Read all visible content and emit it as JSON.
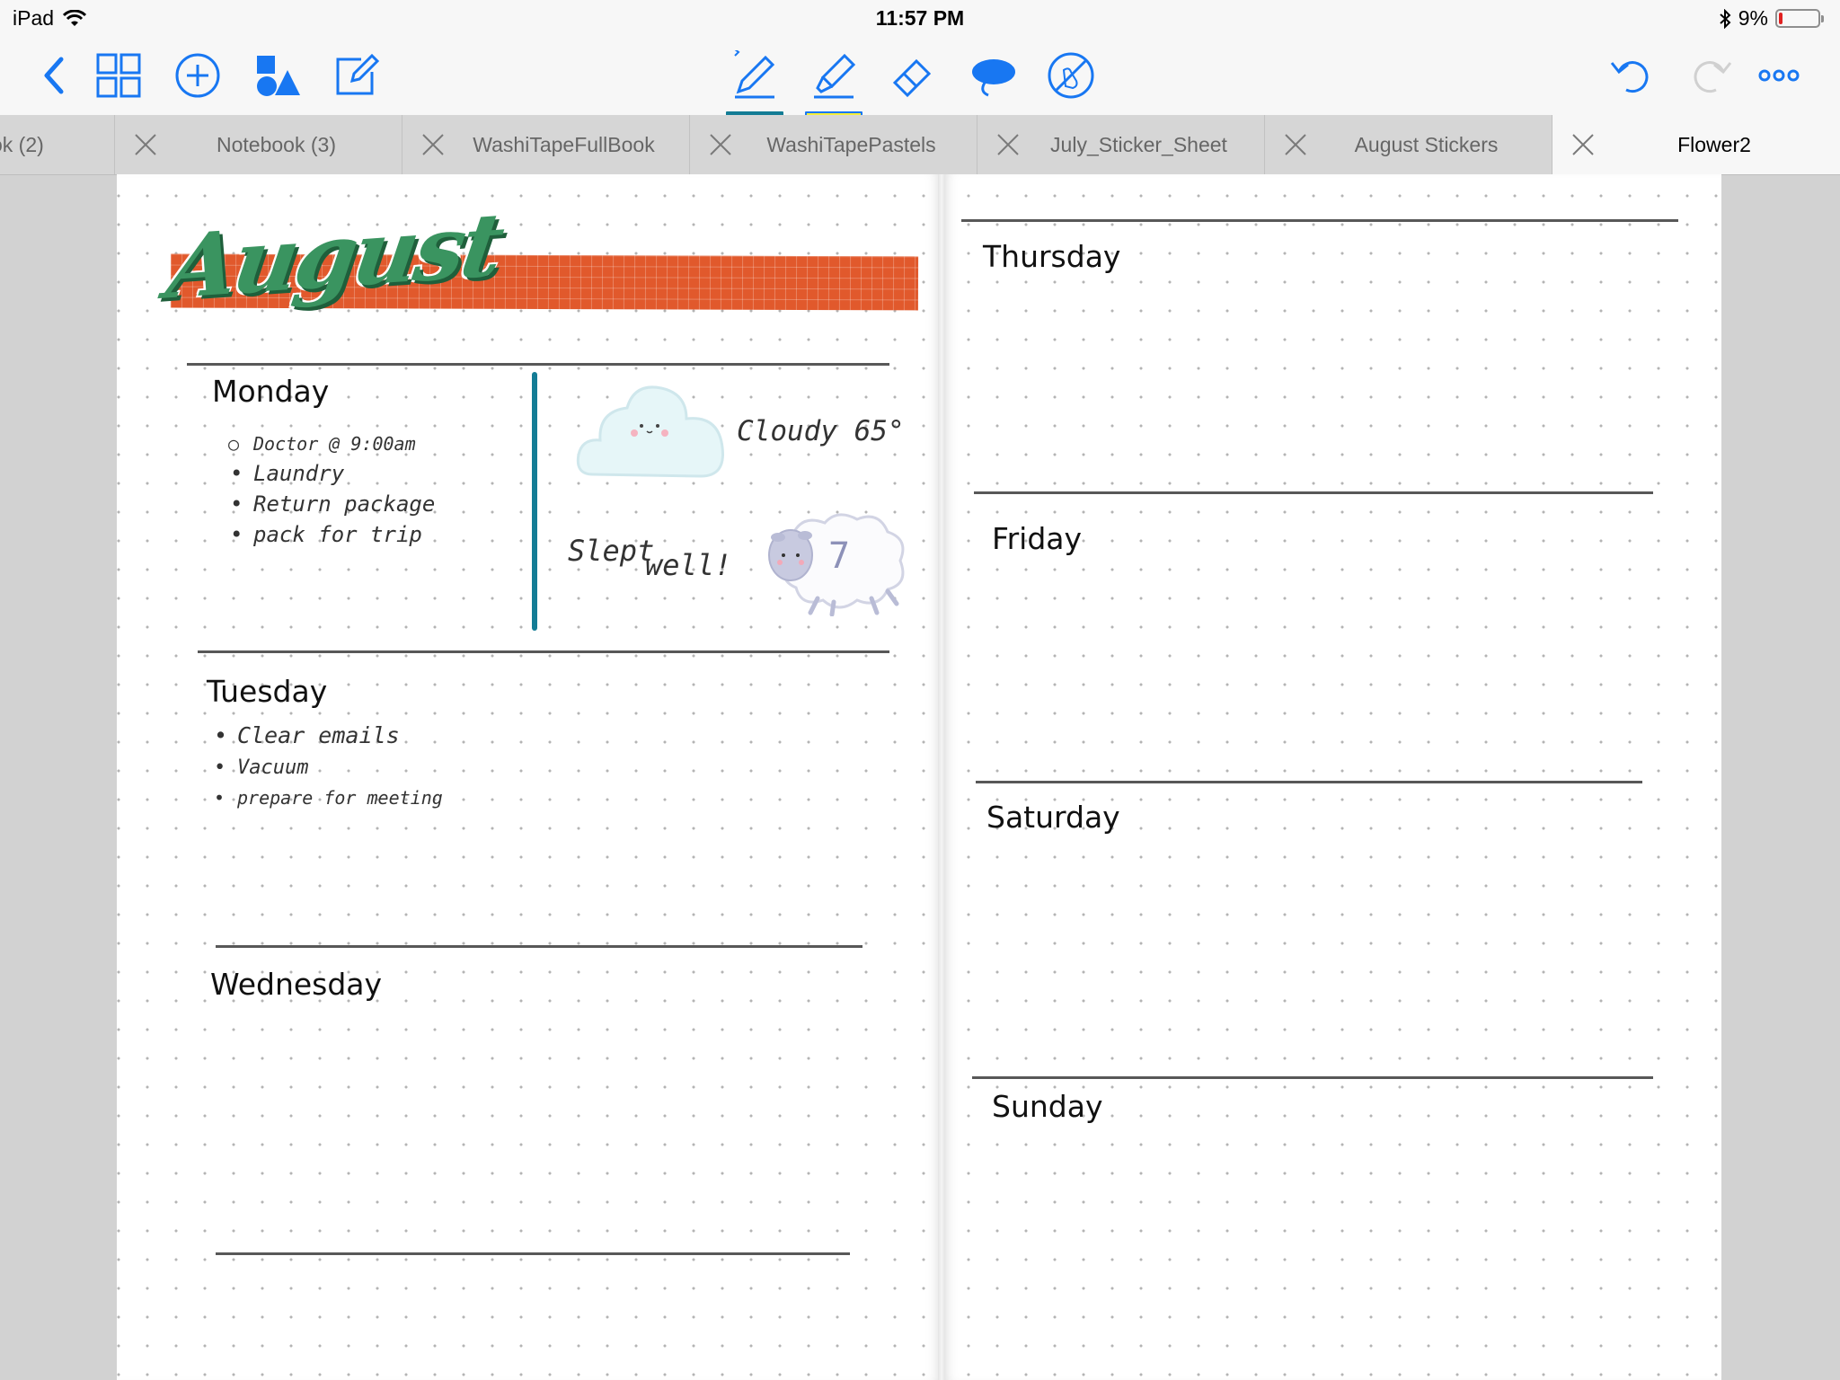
{
  "status_bar": {
    "device": "iPad",
    "time": "11:57 PM",
    "battery_percent": "9%",
    "battery_level": 0.09
  },
  "toolbar": {
    "left_icons": [
      "back-chevron-icon",
      "grid-icon",
      "add-circle-icon",
      "shapes-icon",
      "compose-icon"
    ],
    "tools": [
      "pen-icon",
      "highlighter-icon",
      "eraser-icon",
      "lasso-icon",
      "no-touch-icon"
    ],
    "right_icons": [
      "undo-icon",
      "redo-icon",
      "more-icon"
    ],
    "accent_color": "#1877f2",
    "pen_underline_color": "#137c95",
    "highlighter_underline_color": "#f4ef3a"
  },
  "tabs": [
    {
      "label": "ok (2)",
      "active": false
    },
    {
      "label": "Notebook (3)",
      "active": false
    },
    {
      "label": "WashiTapeFullBook",
      "active": false
    },
    {
      "label": "WashiTapePastels",
      "active": false
    },
    {
      "label": "July_Sticker_Sheet",
      "active": false
    },
    {
      "label": "August Stickers",
      "active": false
    },
    {
      "label": "Flower2",
      "active": true
    }
  ],
  "planner": {
    "title": "August",
    "days": {
      "monday": "Monday",
      "tuesday": "Tuesday",
      "wednesday": "Wednesday",
      "thursday": "Thursday",
      "friday": "Friday",
      "saturday": "Saturday",
      "sunday": "Sunday"
    },
    "monday_items": [
      "Doctor @ 9:00am",
      "Laundry",
      "Return package",
      "pack for trip"
    ],
    "tuesday_items": [
      "Clear emails",
      "Vacuum",
      "prepare for meeting"
    ],
    "weather_note": "Cloudy 65°",
    "sleep_note_1": "Slept",
    "sleep_note_2": "well!",
    "sleep_hours": "7"
  }
}
